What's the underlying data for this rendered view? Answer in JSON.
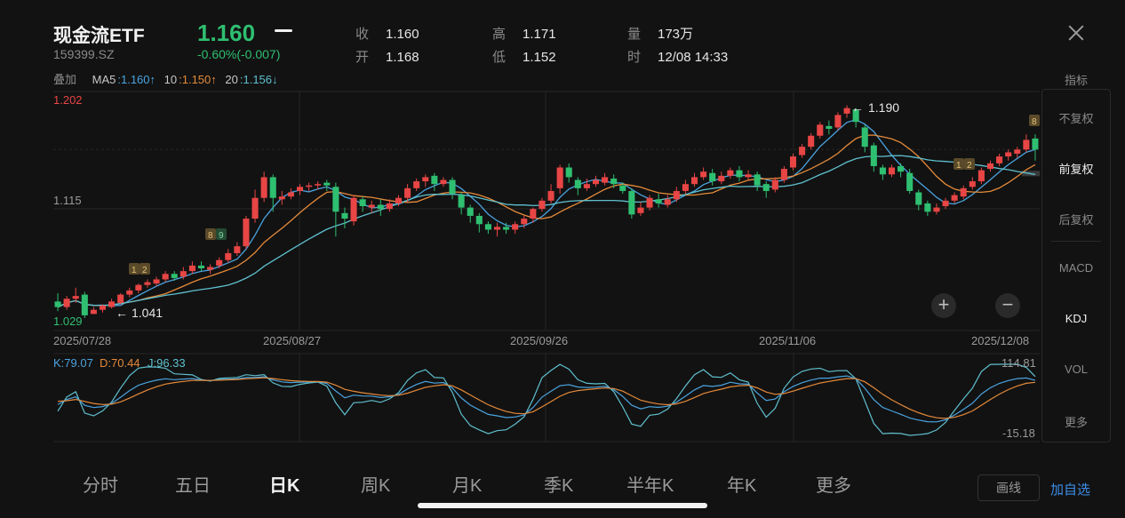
{
  "header": {
    "name": "现金流ETF",
    "code": "159399.SZ",
    "price": "1.160",
    "change": "-0.60%(-0.007)",
    "close_label": "收",
    "close_value": "1.160",
    "open_label": "开",
    "open_value": "1.168",
    "high_label": "高",
    "high_value": "1.171",
    "low_label": "低",
    "low_value": "1.152",
    "volume_label": "量",
    "volume_value": "173万",
    "time_label": "时",
    "time_value": "12/08 14:33"
  },
  "ma_row": {
    "overlay_label": "叠加",
    "ma5_label": "MA5",
    "ma5_value": ":1.160↑",
    "ma10_label": "10",
    "ma10_value": ":1.150↑",
    "ma20_label": "20",
    "ma20_value": ":1.156↓"
  },
  "price_axis": {
    "top": "1.202",
    "mid": "1.115",
    "bottom": "1.029"
  },
  "annotations": {
    "low": "1.041",
    "high": "1.190",
    "badges": [
      "1",
      "2",
      "8",
      "9",
      "8",
      "1",
      "2"
    ]
  },
  "dates": [
    "2025/07/28",
    "2025/08/27",
    "2025/09/26",
    "2025/11/06",
    "2025/12/08"
  ],
  "kdj": {
    "k_label": "K:79.07",
    "d_label": "D:70.44",
    "j_label": "J:96.33",
    "max": "114.81",
    "min": "-15.18"
  },
  "side": {
    "title": "指标",
    "items": [
      "不复权",
      "前复权",
      "后复权",
      "MACD",
      "KDJ",
      "VOL",
      "更多"
    ],
    "active": [
      "前复权",
      "KDJ"
    ]
  },
  "tabs": [
    "分时",
    "五日",
    "日K",
    "周K",
    "月K",
    "季K",
    "半年K",
    "年K",
    "更多"
  ],
  "active_tab": "日K",
  "buttons": {
    "draw": "画线",
    "add_watch": "加自选",
    "zoom_in": "+",
    "zoom_out": "−"
  },
  "colors": {
    "up": "#e84545",
    "down": "#2fbf71",
    "ma5": "#4aa3df",
    "ma10": "#e58a3a",
    "ma20": "#5fc0cf",
    "k": "#4aa3df",
    "d": "#e58a3a",
    "j": "#5fc0cf"
  },
  "chart_data": {
    "type": "candlestick",
    "ylim": [
      1.029,
      1.202
    ],
    "candles": [
      [
        1.05,
        1.046,
        1.056,
        1.043
      ],
      [
        1.046,
        1.052,
        1.054,
        1.044
      ],
      [
        1.052,
        1.054,
        1.06,
        1.049
      ],
      [
        1.055,
        1.04,
        1.057,
        1.038
      ],
      [
        1.041,
        1.044,
        1.046,
        1.041
      ],
      [
        1.044,
        1.047,
        1.048,
        1.042
      ],
      [
        1.046,
        1.05,
        1.052,
        1.045
      ],
      [
        1.049,
        1.055,
        1.056,
        1.048
      ],
      [
        1.055,
        1.058,
        1.06,
        1.053
      ],
      [
        1.058,
        1.062,
        1.063,
        1.056
      ],
      [
        1.062,
        1.064,
        1.066,
        1.06
      ],
      [
        1.063,
        1.066,
        1.068,
        1.061
      ],
      [
        1.066,
        1.07,
        1.072,
        1.064
      ],
      [
        1.07,
        1.067,
        1.072,
        1.065
      ],
      [
        1.068,
        1.072,
        1.075,
        1.066
      ],
      [
        1.072,
        1.076,
        1.079,
        1.07
      ],
      [
        1.076,
        1.074,
        1.079,
        1.072
      ],
      [
        1.073,
        1.075,
        1.077,
        1.07
      ],
      [
        1.076,
        1.08,
        1.082,
        1.074
      ],
      [
        1.08,
        1.085,
        1.088,
        1.078
      ],
      [
        1.085,
        1.09,
        1.093,
        1.083
      ],
      [
        1.09,
        1.11,
        1.112,
        1.088
      ],
      [
        1.11,
        1.125,
        1.131,
        1.107
      ],
      [
        1.125,
        1.14,
        1.144,
        1.122
      ],
      [
        1.14,
        1.125,
        1.142,
        1.115
      ],
      [
        1.124,
        1.126,
        1.13,
        1.12
      ],
      [
        1.126,
        1.129,
        1.132,
        1.124
      ],
      [
        1.13,
        1.133,
        1.135,
        1.127
      ],
      [
        1.133,
        1.134,
        1.136,
        1.13
      ],
      [
        1.134,
        1.135,
        1.137,
        1.131
      ],
      [
        1.136,
        1.134,
        1.138,
        1.13
      ],
      [
        1.133,
        1.115,
        1.136,
        1.097
      ],
      [
        1.114,
        1.11,
        1.118,
        1.103
      ],
      [
        1.108,
        1.125,
        1.127,
        1.105
      ],
      [
        1.124,
        1.119,
        1.126,
        1.115
      ],
      [
        1.118,
        1.12,
        1.123,
        1.114
      ],
      [
        1.12,
        1.117,
        1.124,
        1.112
      ],
      [
        1.117,
        1.121,
        1.124,
        1.115
      ],
      [
        1.121,
        1.125,
        1.127,
        1.119
      ],
      [
        1.125,
        1.132,
        1.135,
        1.122
      ],
      [
        1.132,
        1.137,
        1.139,
        1.13
      ],
      [
        1.137,
        1.14,
        1.142,
        1.133
      ],
      [
        1.141,
        1.135,
        1.143,
        1.13
      ],
      [
        1.135,
        1.138,
        1.14,
        1.133
      ],
      [
        1.138,
        1.128,
        1.14,
        1.124
      ],
      [
        1.127,
        1.118,
        1.129,
        1.113
      ],
      [
        1.118,
        1.112,
        1.12,
        1.107
      ],
      [
        1.112,
        1.106,
        1.114,
        1.1
      ],
      [
        1.106,
        1.102,
        1.108,
        1.099
      ],
      [
        1.102,
        1.104,
        1.107,
        1.097
      ],
      [
        1.104,
        1.102,
        1.107,
        1.099
      ],
      [
        1.102,
        1.106,
        1.108,
        1.099
      ],
      [
        1.106,
        1.11,
        1.112,
        1.103
      ],
      [
        1.11,
        1.117,
        1.118,
        1.107
      ],
      [
        1.117,
        1.123,
        1.125,
        1.115
      ],
      [
        1.123,
        1.13,
        1.135,
        1.121
      ],
      [
        1.132,
        1.147,
        1.149,
        1.128
      ],
      [
        1.147,
        1.14,
        1.15,
        1.136
      ],
      [
        1.138,
        1.132,
        1.14,
        1.127
      ],
      [
        1.132,
        1.135,
        1.139,
        1.13
      ],
      [
        1.135,
        1.138,
        1.141,
        1.133
      ],
      [
        1.136,
        1.14,
        1.143,
        1.134
      ],
      [
        1.139,
        1.135,
        1.142,
        1.132
      ],
      [
        1.134,
        1.13,
        1.136,
        1.128
      ],
      [
        1.13,
        1.113,
        1.132,
        1.11
      ],
      [
        1.114,
        1.118,
        1.122,
        1.112
      ],
      [
        1.118,
        1.125,
        1.127,
        1.116
      ],
      [
        1.124,
        1.121,
        1.128,
        1.118
      ],
      [
        1.12,
        1.124,
        1.127,
        1.118
      ],
      [
        1.124,
        1.13,
        1.133,
        1.122
      ],
      [
        1.13,
        1.135,
        1.138,
        1.128
      ],
      [
        1.135,
        1.14,
        1.143,
        1.133
      ],
      [
        1.14,
        1.144,
        1.147,
        1.138
      ],
      [
        1.143,
        1.137,
        1.146,
        1.134
      ],
      [
        1.137,
        1.141,
        1.144,
        1.135
      ],
      [
        1.141,
        1.145,
        1.147,
        1.139
      ],
      [
        1.145,
        1.14,
        1.148,
        1.137
      ],
      [
        1.14,
        1.142,
        1.145,
        1.138
      ],
      [
        1.142,
        1.134,
        1.144,
        1.13
      ],
      [
        1.135,
        1.13,
        1.137,
        1.125
      ],
      [
        1.131,
        1.138,
        1.14,
        1.129
      ],
      [
        1.138,
        1.146,
        1.148,
        1.136
      ],
      [
        1.147,
        1.155,
        1.157,
        1.145
      ],
      [
        1.156,
        1.162,
        1.164,
        1.154
      ],
      [
        1.162,
        1.17,
        1.172,
        1.16
      ],
      [
        1.17,
        1.178,
        1.18,
        1.168
      ],
      [
        1.177,
        1.175,
        1.181,
        1.171
      ],
      [
        1.176,
        1.185,
        1.187,
        1.174
      ],
      [
        1.186,
        1.19,
        1.192,
        1.183
      ],
      [
        1.189,
        1.18,
        1.19,
        1.176
      ],
      [
        1.176,
        1.162,
        1.178,
        1.158
      ],
      [
        1.163,
        1.148,
        1.165,
        1.144
      ],
      [
        1.147,
        1.142,
        1.149,
        1.138
      ],
      [
        1.142,
        1.147,
        1.149,
        1.14
      ],
      [
        1.148,
        1.144,
        1.15,
        1.14
      ],
      [
        1.143,
        1.13,
        1.146,
        1.128
      ],
      [
        1.129,
        1.12,
        1.131,
        1.116
      ],
      [
        1.121,
        1.115,
        1.123,
        1.112
      ],
      [
        1.115,
        1.118,
        1.121,
        1.113
      ],
      [
        1.119,
        1.123,
        1.125,
        1.117
      ],
      [
        1.123,
        1.127,
        1.129,
        1.121
      ],
      [
        1.126,
        1.132,
        1.134,
        1.124
      ],
      [
        1.133,
        1.137,
        1.14,
        1.131
      ],
      [
        1.137,
        1.145,
        1.147,
        1.135
      ],
      [
        1.146,
        1.15,
        1.152,
        1.144
      ],
      [
        1.15,
        1.155,
        1.157,
        1.148
      ],
      [
        1.155,
        1.158,
        1.16,
        1.152
      ],
      [
        1.157,
        1.16,
        1.162,
        1.154
      ],
      [
        1.16,
        1.167,
        1.171,
        1.158
      ],
      [
        1.168,
        1.16,
        1.171,
        1.152
      ]
    ]
  }
}
